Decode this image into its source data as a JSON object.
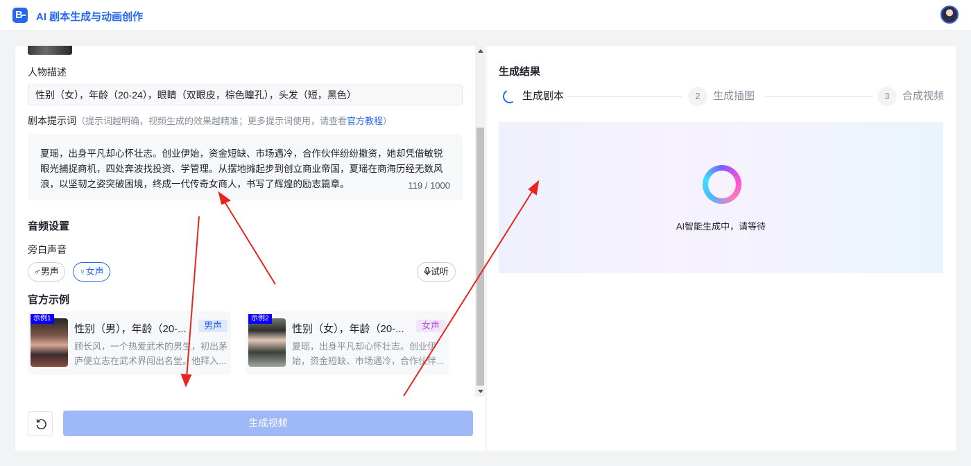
{
  "header": {
    "logo_letter": "B",
    "title": "AI 剧本生成与动画创作"
  },
  "left": {
    "character_desc_label": "人物描述",
    "character_desc_value": "性别（女），年龄（20-24），眼睛（双眼皮，棕色瞳孔），头发（短，黑色）",
    "prompt_label": "剧本提示词",
    "prompt_hint": "（提示词越明确，视频生成的效果越精准；更多提示词使用，请查看",
    "prompt_hint_link": "官方教程",
    "prompt_hint_end": "）",
    "prompt_text": "夏瑶，出身平凡却心怀壮志。创业伊始，资金短缺、市场遇冷，合作伙伴纷纷撤资，她却凭借敏锐眼光捕捉商机，四处奔波找投资、学管理。从摆地摊起步到创立商业帝国，夏瑶在商海历经无数风浪，以坚韧之姿突破困境，终成一代传奇女商人，书写了辉煌的励志篇章。",
    "prompt_counter": "119 / 1000",
    "audio_title": "音频设置",
    "narration_label": "旁白声音",
    "voice_male": "♂男声",
    "voice_female": "♀女声",
    "listen": "试听",
    "examples_title": "官方示例",
    "examples": [
      {
        "badge": "示例1",
        "title": "性别（男），年龄（20-...",
        "tag": "男声",
        "text": "顾长风，一个热爱武术的男生，初出茅庐便立志在武术界闯出名堂。他拜入..."
      },
      {
        "badge": "示例2",
        "title": "性别（女），年龄（20-...",
        "tag": "女声",
        "text": "夏瑶，出身平凡却心怀壮志。创业伊始，资金短缺、市场遇冷，合作伙伴..."
      }
    ],
    "generate_button": "生成视频"
  },
  "right": {
    "title": "生成结果",
    "steps": [
      {
        "num": "",
        "label": "生成剧本"
      },
      {
        "num": "2",
        "label": "生成插图"
      },
      {
        "num": "3",
        "label": "合成视频"
      }
    ],
    "loading_text": "AI智能生成中，请等待"
  },
  "colors": {
    "accent": "#2468f2",
    "arrow": "#e8251c",
    "male_tag_bg": "#dfe8fd",
    "female_tag_bg": "#f3e3fb"
  },
  "icons": {
    "reset": "refresh-icon",
    "mic": "mic-icon"
  }
}
